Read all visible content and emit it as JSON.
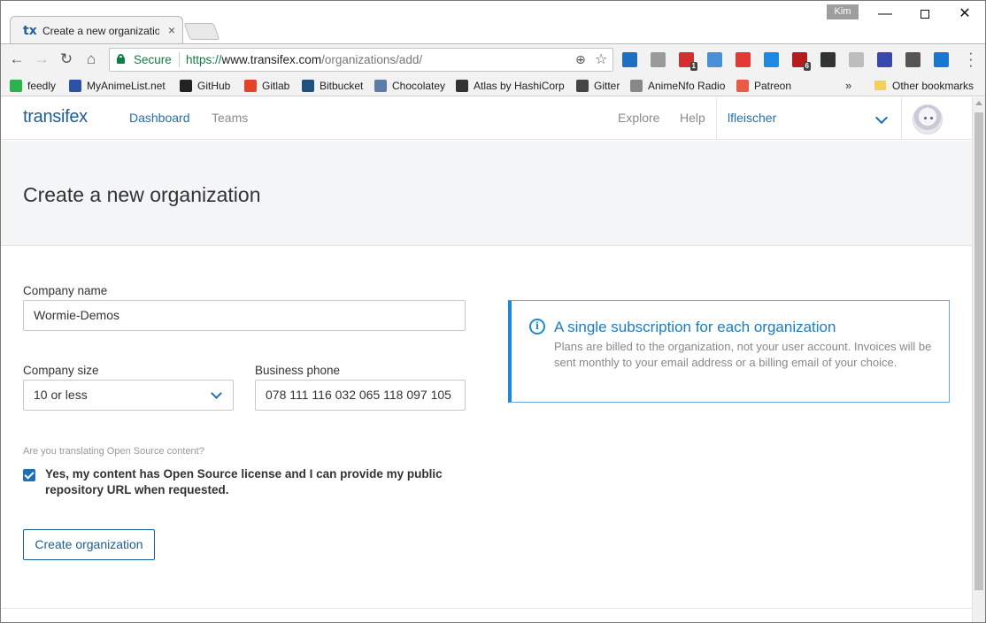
{
  "browser": {
    "tab_title": "Create a new organizatio",
    "tab_favicon": "tx",
    "tab_close": "×",
    "profile_name": "Kim",
    "window_min": "—",
    "window_close": "✕",
    "secure_label": "Secure",
    "url_scheme": "https://",
    "url_host": "www.transifex.com",
    "url_path": "/organizations/add/",
    "bookmarks": [
      {
        "label": "feedly",
        "color": "#2bb24c"
      },
      {
        "label": "MyAnimeList.net",
        "color": "#2e51a2"
      },
      {
        "label": "GitHub",
        "color": "#222222"
      },
      {
        "label": "Gitlab",
        "color": "#e24329"
      },
      {
        "label": "Bitbucket",
        "color": "#205081"
      },
      {
        "label": "Chocolatey",
        "color": "#5c7caa"
      },
      {
        "label": "Atlas by HashiCorp",
        "color": "#333333"
      },
      {
        "label": "Gitter",
        "color": "#444444"
      },
      {
        "label": "AnimeNfo Radio",
        "color": "#888888"
      },
      {
        "label": "Patreon",
        "color": "#e85b46"
      }
    ],
    "bookmarks_more": "»",
    "other_bookmarks": "Other bookmarks",
    "extensions": [
      {
        "name": "extension-icon",
        "color": "#1e6fc0",
        "badge": ""
      },
      {
        "name": "extension-icon",
        "color": "#9a9a9a",
        "badge": ""
      },
      {
        "name": "extension-icon",
        "color": "#d32f2f",
        "badge": "1"
      },
      {
        "name": "extension-icon",
        "color": "#4a90d9",
        "badge": ""
      },
      {
        "name": "extension-icon",
        "color": "#e53935",
        "badge": ""
      },
      {
        "name": "extension-icon",
        "color": "#1e88e5",
        "badge": ""
      },
      {
        "name": "extension-icon",
        "color": "#b71c1c",
        "badge": "6"
      },
      {
        "name": "extension-icon",
        "color": "#333333",
        "badge": ""
      },
      {
        "name": "extension-icon",
        "color": "#bdbdbd",
        "badge": ""
      },
      {
        "name": "extension-icon",
        "color": "#3949ab",
        "badge": ""
      },
      {
        "name": "extension-icon",
        "color": "#555555",
        "badge": ""
      },
      {
        "name": "extension-icon",
        "color": "#1976d2",
        "badge": ""
      }
    ]
  },
  "app": {
    "logo": "transifex",
    "nav": {
      "dashboard": "Dashboard",
      "teams": "Teams",
      "explore": "Explore",
      "help": "Help",
      "username": "lfleischer"
    },
    "accent": "#1d6fb8"
  },
  "page": {
    "title": "Create a new organization",
    "form": {
      "company_name_label": "Company name",
      "company_name_value": "Wormie-Demos",
      "company_size_label": "Company size",
      "company_size_value": "10 or less",
      "business_phone_label": "Business phone",
      "business_phone_value": "078 111 116 032 065 118 097 105",
      "open_source_question": "Are you translating Open Source content?",
      "open_source_checkbox_label": "Yes, my content has Open Source license and I can provide my public repository URL when requested.",
      "open_source_checked": true,
      "submit_label": "Create organization"
    },
    "info": {
      "title": "A single subscription for each organization",
      "text": "Plans are billed to the organization, not your user account. Invoices will be sent monthly to your email address or a billing email of your choice."
    }
  }
}
